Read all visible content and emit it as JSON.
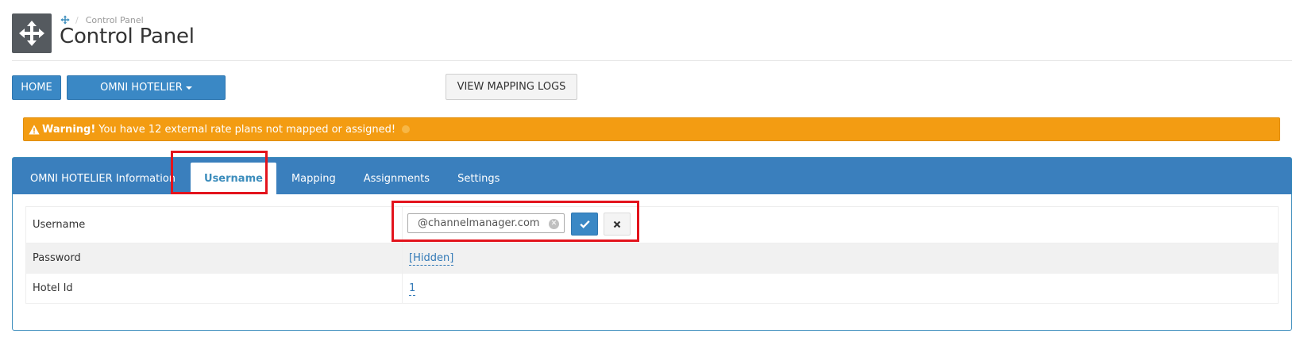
{
  "header": {
    "breadcrumb": "Control Panel",
    "title": "Control Panel"
  },
  "toolbar": {
    "home_label": "HOME",
    "channel_label": "OMNI HOTELIER",
    "logs_label": "VIEW MAPPING LOGS"
  },
  "alert": {
    "title": "Warning!",
    "message": "You have 12 external rate plans not mapped or assigned!"
  },
  "tabs": [
    {
      "label": "OMNI HOTELIER Information",
      "active": false
    },
    {
      "label": "Username",
      "active": true
    },
    {
      "label": "Mapping",
      "active": false
    },
    {
      "label": "Assignments",
      "active": false
    },
    {
      "label": "Settings",
      "active": false
    }
  ],
  "fields": [
    {
      "label": "Username",
      "value": "@channelmanager.com"
    },
    {
      "label": "Password",
      "value": "[Hidden]"
    },
    {
      "label": "Hotel Id",
      "value": "1"
    }
  ],
  "colors": {
    "primary": "#3a88c5",
    "tab_bar": "#3a7fbd",
    "warning": "#f39c12",
    "highlight": "#e3141d",
    "header_icon_bg": "#555a5f"
  },
  "icons": {
    "header": "arrows-move-icon",
    "breadcrumb": "arrows-move-icon",
    "alert": "warning-triangle-icon",
    "clear": "clear-circle-icon",
    "confirm": "check-icon",
    "cancel": "x-icon"
  }
}
